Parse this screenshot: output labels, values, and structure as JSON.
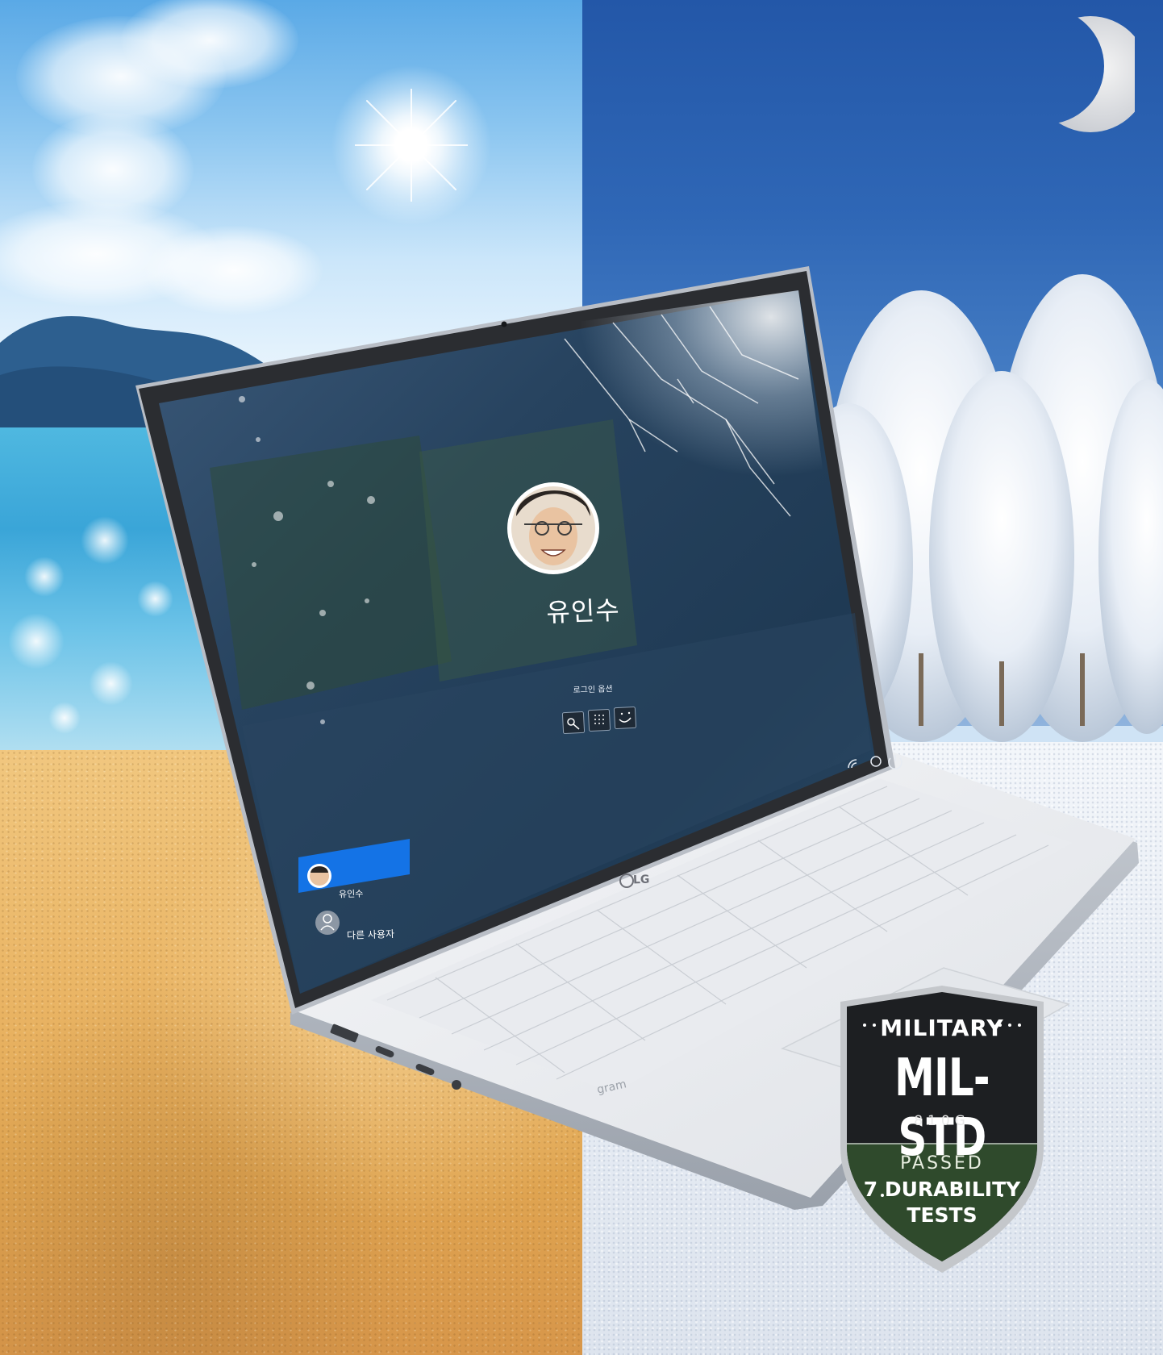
{
  "screen": {
    "user_name": "유인수",
    "login_options_label": "로그인 옵션",
    "user_list": [
      {
        "label": "유인수",
        "selected": true
      },
      {
        "label": "다른 사용자",
        "selected": false
      }
    ]
  },
  "laptop": {
    "brand": "LG",
    "model": "gram"
  },
  "badge": {
    "line1": "MILITARY",
    "line2": "MIL-STD",
    "line3": "810G",
    "line4": "PASSED",
    "line5": "7 DURABILITY",
    "line6": "TESTS"
  },
  "colors": {
    "summer_sky": "#8cc6f0",
    "winter_sky": "#2f67b6",
    "sand": "#eab565",
    "snow": "#e9eef5",
    "selection_blue": "#1473e6",
    "badge_dark": "#1d1f22",
    "badge_green": "#2f4a2c"
  }
}
